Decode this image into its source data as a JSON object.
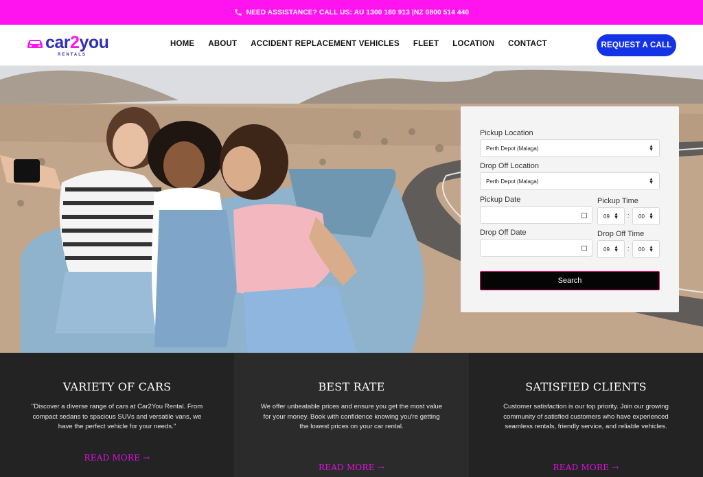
{
  "topbar": {
    "text": "NEED ASSISTANCE? CALL US:  AU 1300 180 913  |NZ 0800 514 440",
    "icon": "phone-icon"
  },
  "header": {
    "logo": {
      "word_a": "car",
      "word_b": "2",
      "word_c": "you",
      "sub": "RENTALS"
    },
    "nav": [
      "HOME",
      "ABOUT",
      "ACCIDENT REPLACEMENT VEHICLES",
      "FLEET",
      "LOCATION",
      "CONTACT"
    ],
    "cta": "REQUEST A CALL"
  },
  "search": {
    "pickup_location_label": "Pickup Location",
    "pickup_location_value": "Perth Depot (Malaga)",
    "dropoff_location_label": "Drop Off Location",
    "dropoff_location_value": "Perth Depot (Malaga)",
    "pickup_date_label": "Pickup Date",
    "pickup_time_label": "Pickup Time",
    "pickup_hour": "09",
    "pickup_minute": "00",
    "dropoff_date_label": "Drop Off Date",
    "dropoff_time_label": "Drop Off Time",
    "dropoff_hour": "09",
    "dropoff_minute": "00",
    "time_separator": ":",
    "button": "Search"
  },
  "features": [
    {
      "title": "VARIETY OF CARS",
      "text": "\"Discover a diverse range of cars at Car2You Rental. From compact sedans to spacious SUVs and versatile vans, we have the perfect vehicle for your needs.\"",
      "link": "READ MORE →"
    },
    {
      "title": "BEST RATE",
      "text": "We offer unbeatable prices and ensure you get the most value for your money. Book with confidence knowing you're getting the lowest prices on your car rental.",
      "link": "READ MORE →"
    },
    {
      "title": "SATISFIED CLIENTS",
      "text": "Customer satisfaction is our top priority. Join our growing community of satisfied customers who have experienced seamless rentals, friendly service, and reliable vehicles.",
      "link": "READ MORE →"
    }
  ],
  "colors": {
    "topbar": "#ff14f0",
    "brand_blue": "#1432e6",
    "feature_bg_1": "#232323",
    "feature_bg_2": "#2b2b2b",
    "feature_bg_3": "#232323",
    "read_more": "#e010e0"
  }
}
